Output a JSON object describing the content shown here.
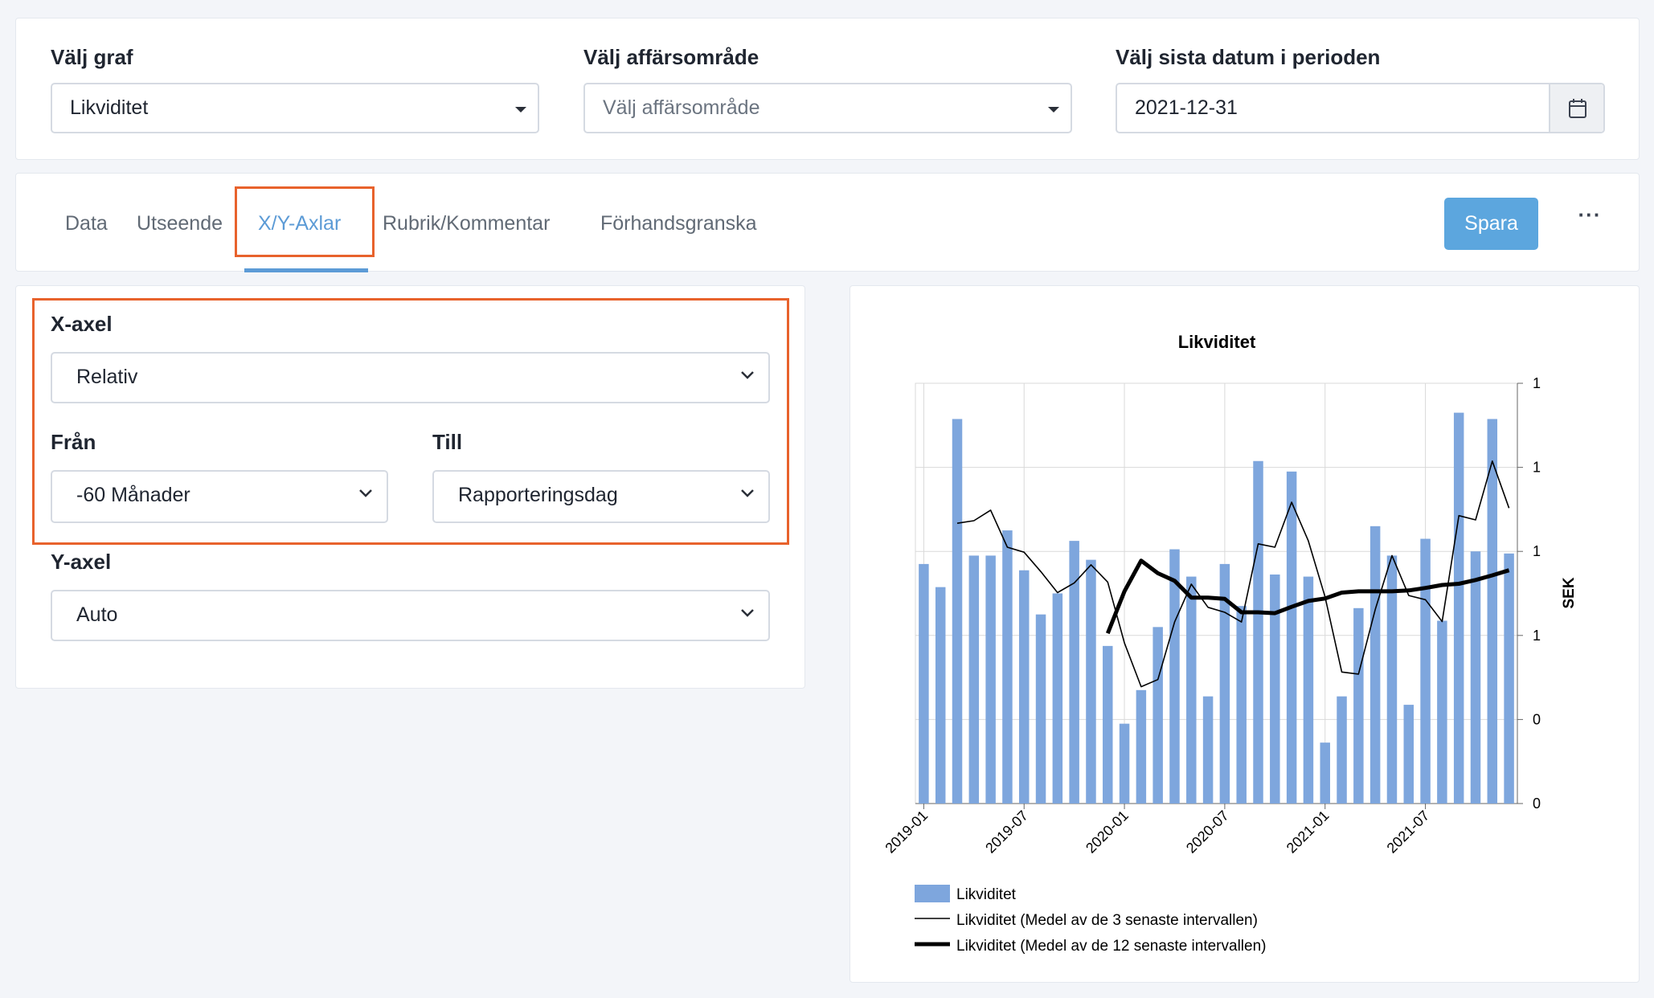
{
  "top": {
    "graph": {
      "label": "Välj graf",
      "value": "Likviditet"
    },
    "area": {
      "label": "Välj affärsområde",
      "placeholder": "Välj affärsområde"
    },
    "date": {
      "label": "Välj sista datum i perioden",
      "value": "2021-12-31"
    }
  },
  "tabs": [
    {
      "label": "Data",
      "active": false
    },
    {
      "label": "Utseende",
      "active": false
    },
    {
      "label": "X/Y-Axlar",
      "active": true
    },
    {
      "label": "Rubrik/Kommentar",
      "active": false
    },
    {
      "label": "Förhandsgranska",
      "active": false
    }
  ],
  "toolbar": {
    "save_label": "Spara",
    "more_label": "···"
  },
  "axis": {
    "x_label": "X-axel",
    "x_value": "Relativ",
    "from_label": "Från",
    "from_value": "-60 Månader",
    "to_label": "Till",
    "to_value": "Rapporteringsdag",
    "y_label": "Y-axel",
    "y_value": "Auto"
  },
  "colors": {
    "accent": "#5c9bd6",
    "highlight": "#e8622c",
    "bar": "#7ea6dd",
    "save": "#5ca6de"
  },
  "chart_data": {
    "type": "bar",
    "title": "Likviditet",
    "ylabel": "SEK",
    "ylim": [
      0,
      1
    ],
    "ytick_labels": [
      "0",
      "0",
      "1",
      "1",
      "1",
      "1"
    ],
    "xtick_labels": [
      "2019-01",
      "2019-07",
      "2020-01",
      "2020-07",
      "2021-01",
      "2021-07"
    ],
    "x": [
      "2019-01",
      "2019-02",
      "2019-03",
      "2019-04",
      "2019-05",
      "2019-06",
      "2019-07",
      "2019-08",
      "2019-09",
      "2019-10",
      "2019-11",
      "2019-12",
      "2020-01",
      "2020-02",
      "2020-03",
      "2020-04",
      "2020-05",
      "2020-06",
      "2020-07",
      "2020-08",
      "2020-09",
      "2020-10",
      "2020-11",
      "2020-12",
      "2021-01",
      "2021-02",
      "2021-03",
      "2021-04",
      "2021-05",
      "2021-06",
      "2021-07",
      "2021-08",
      "2021-09",
      "2021-10",
      "2021-11",
      "2021-12"
    ],
    "series": [
      {
        "name": "Likviditet",
        "kind": "bar",
        "values": [
          0.57,
          0.515,
          0.915,
          0.59,
          0.59,
          0.65,
          0.555,
          0.45,
          0.5,
          0.625,
          0.58,
          0.375,
          0.19,
          0.27,
          0.42,
          0.605,
          0.54,
          0.255,
          0.57,
          0.47,
          0.815,
          0.545,
          0.79,
          0.54,
          0.145,
          0.255,
          0.465,
          0.66,
          0.59,
          0.235,
          0.63,
          0.435,
          0.93,
          0.6,
          0.915,
          0.595
        ]
      },
      {
        "name": "Likviditet (Medel av de 3 senaste intervallen)",
        "kind": "line",
        "values": [
          null,
          null,
          0.667,
          0.673,
          0.698,
          0.61,
          0.598,
          0.552,
          0.502,
          0.525,
          0.568,
          0.527,
          0.382,
          0.278,
          0.295,
          0.432,
          0.522,
          0.467,
          0.455,
          0.432,
          0.618,
          0.61,
          0.717,
          0.625,
          0.492,
          0.313,
          0.308,
          0.462,
          0.59,
          0.495,
          0.485,
          0.433,
          0.685,
          0.675,
          0.815,
          0.703
        ]
      },
      {
        "name": "Likviditet (Medel av de 12 senaste intervallen)",
        "kind": "line",
        "values": [
          null,
          null,
          null,
          null,
          null,
          null,
          null,
          null,
          null,
          null,
          null,
          0.405,
          0.505,
          0.578,
          0.548,
          0.53,
          0.49,
          0.49,
          0.487,
          0.455,
          0.455,
          0.453,
          0.468,
          0.482,
          0.488,
          0.502,
          0.505,
          0.505,
          0.505,
          0.507,
          0.513,
          0.52,
          0.523,
          0.532,
          0.543,
          0.555
        ]
      }
    ]
  }
}
